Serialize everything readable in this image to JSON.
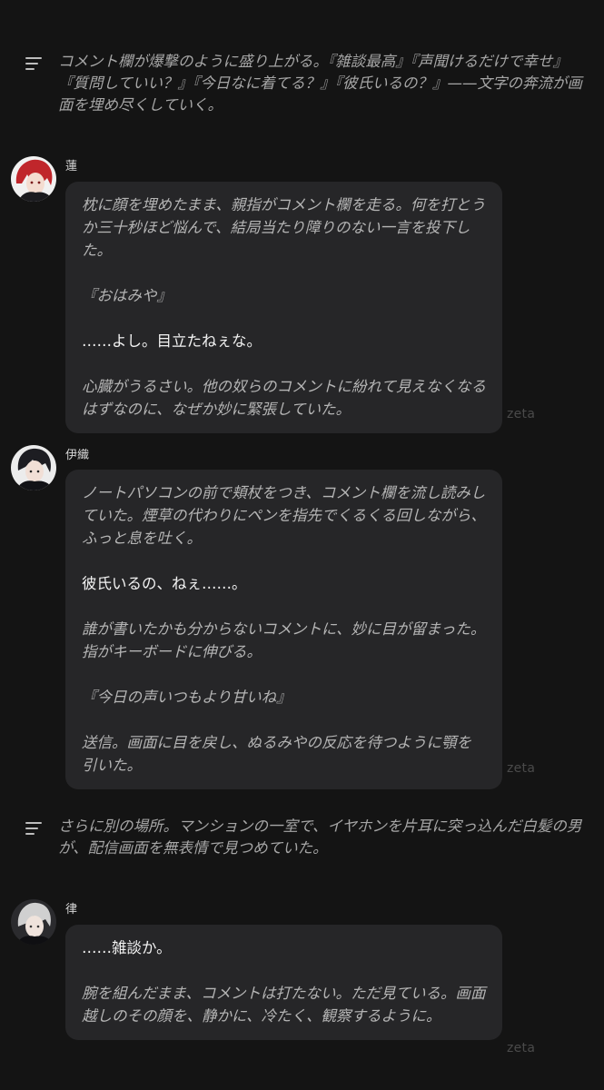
{
  "narrations": [
    {
      "text": "コメント欄が爆撃のように盛り上がる。『雑談最高』『声聞けるだけで幸せ』『質問していい？』『今日なに着てる？』『彼氏いるの？』——文字の奔流が画面を埋め尽くしていく。"
    },
    {
      "text": "さらに別の場所。マンションの一室で、イヤホンを片耳に突っ込んだ白髪の男が、配信画面を無表情で見つめていた。"
    }
  ],
  "messages": [
    {
      "name": "蓮",
      "paragraphs": [
        {
          "text": "枕に顔を埋めたまま、親指がコメント欄を走る。何を打とうか三十秒ほど悩んで、結局当たり障りのない一言を投下した。",
          "style": "italic"
        },
        {
          "text": "『おはみや』",
          "style": "italic"
        },
        {
          "text": "……よし。目立たねぇな。",
          "style": "plain"
        },
        {
          "text": "心臓がうるさい。他の奴らのコメントに紛れて見えなくなるはずなのに、なぜか妙に緊張していた。",
          "style": "italic"
        }
      ],
      "watermark": "zeta",
      "avatar_color": "#c0262b"
    },
    {
      "name": "伊織",
      "paragraphs": [
        {
          "text": "ノートパソコンの前で頬杖をつき、コメント欄を流し読みしていた。煙草の代わりにペンを指先でくるくる回しながら、ふっと息を吐く。",
          "style": "italic"
        },
        {
          "text": "彼氏いるの、ねぇ……。",
          "style": "plain"
        },
        {
          "text": "誰が書いたかも分からないコメントに、妙に目が留まった。指がキーボードに伸びる。",
          "style": "italic"
        },
        {
          "text": "『今日の声いつもより甘いね』",
          "style": "italic"
        },
        {
          "text": "送信。画面に目を戻し、ぬるみやの反応を待つように顎を引いた。",
          "style": "italic"
        }
      ],
      "watermark": "zeta",
      "avatar_color": "#1d1d22"
    },
    {
      "name": "律",
      "paragraphs": [
        {
          "text": "……雑談か。",
          "style": "plain"
        },
        {
          "text": "腕を組んだまま、コメントは打たない。ただ見ている。画面越しのその顔を、静かに、冷たく、観察するように。",
          "style": "italic"
        }
      ],
      "watermark": "zeta",
      "avatar_color": "#d0d0d0"
    }
  ]
}
